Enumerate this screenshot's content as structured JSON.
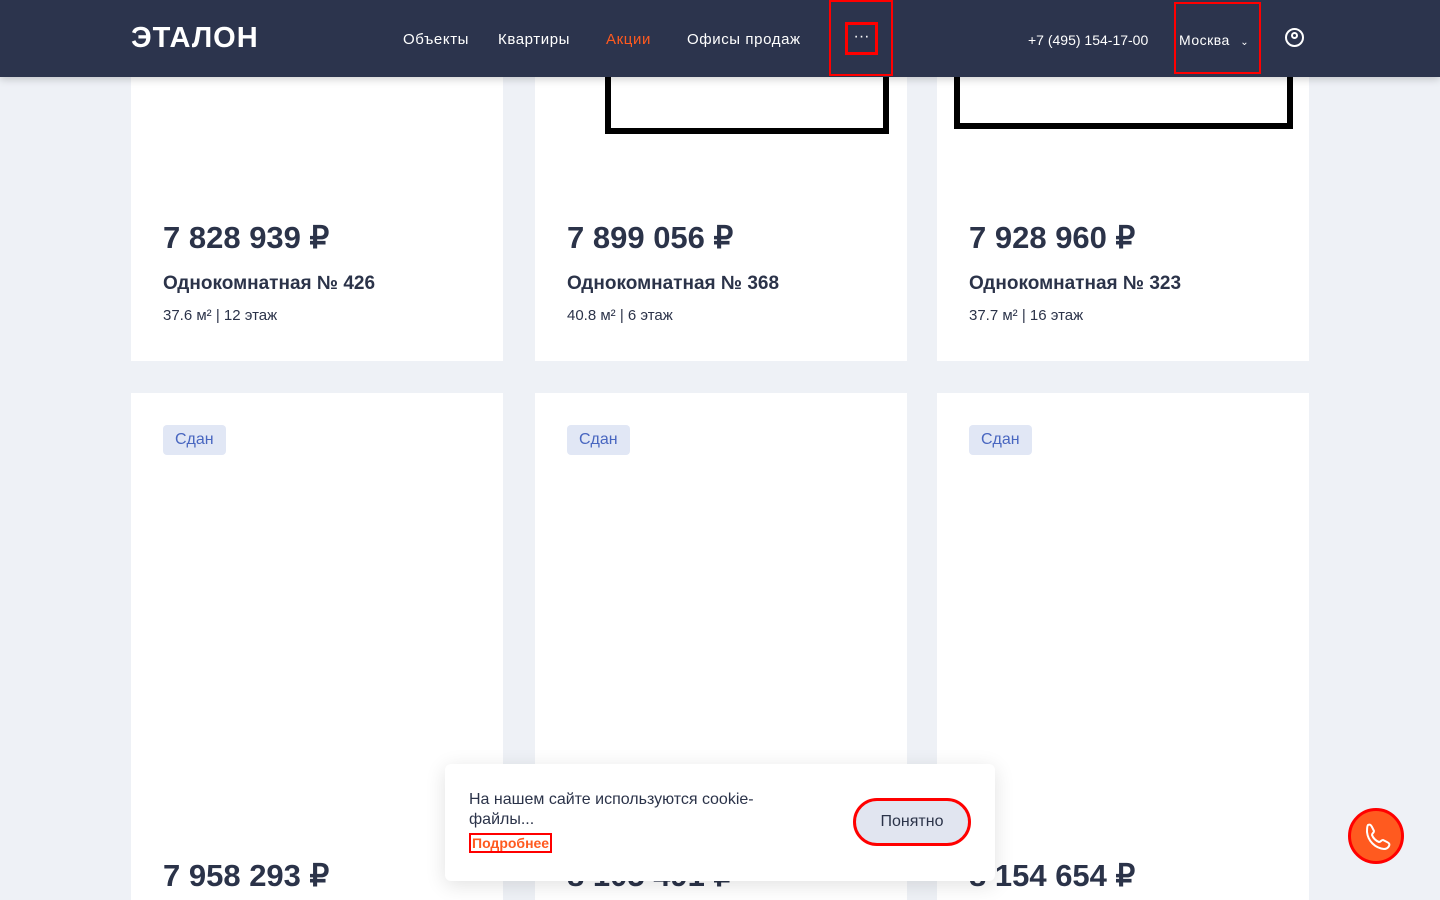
{
  "header": {
    "logo": "ЭТАЛОН",
    "nav": [
      "Объекты",
      "Квартиры",
      "Акции",
      "Офисы продаж"
    ],
    "active_nav": "Акции",
    "more_label": "···",
    "phone": "+7 (495) 154-17-00",
    "city": "Москва"
  },
  "colors": {
    "header_bg": "#2c344d",
    "accent": "#ff5a1f",
    "badge_bg": "#e1e7f5",
    "badge_text": "#4866c0"
  },
  "cards": [
    {
      "price": "7 828 939 ₽",
      "title": "Однокомнатная № 426",
      "meta": "37.6 м² | 12 этаж"
    },
    {
      "price": "7 899 056 ₽",
      "title": "Однокомнатная № 368",
      "meta": "40.8 м² | 6 этаж"
    },
    {
      "price": "7 928 960 ₽",
      "title": "Однокомнатная № 323",
      "meta": "37.7 м² | 16 этаж"
    },
    {
      "badge": "Сдан",
      "price": "7 958 293 ₽"
    },
    {
      "badge": "Сдан",
      "price": "8 105 491 ₽"
    },
    {
      "badge": "Сдан",
      "price": "8 154 654 ₽"
    }
  ],
  "cookie": {
    "text": "На нашем сайте используются cookie-файлы...",
    "link": "Подробнее",
    "button": "Понятно"
  }
}
